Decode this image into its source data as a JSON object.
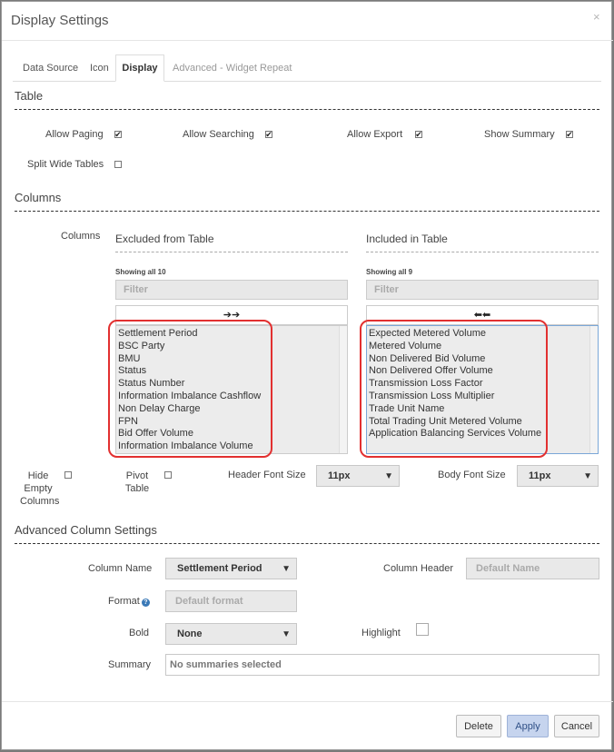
{
  "dialog": {
    "title": "Display Settings",
    "close_glyph": "×"
  },
  "tabs": [
    {
      "label": "Data Source"
    },
    {
      "label": "Icon"
    },
    {
      "label": "Display"
    },
    {
      "label": "Advanced - Widget Repeat"
    }
  ],
  "table_section": {
    "title": "Table",
    "allow_paging": {
      "label": "Allow Paging",
      "checked": true
    },
    "allow_searching": {
      "label": "Allow Searching",
      "checked": true
    },
    "allow_export": {
      "label": "Allow Export",
      "checked": true
    },
    "show_summary": {
      "label": "Show Summary",
      "checked": true
    },
    "split_wide_tables": {
      "label": "Split Wide Tables",
      "checked": false
    },
    "check_glyph": "✔"
  },
  "columns_section": {
    "title": "Columns",
    "label": "Columns",
    "excluded": {
      "title": "Excluded from Table",
      "count_text": "Showing all 10",
      "filter_placeholder": "Filter",
      "move_glyph": "➔➔",
      "items": [
        "Settlement Period",
        "BSC Party",
        "BMU",
        "Status",
        "Status Number",
        "Information Imbalance Cashflow",
        "Non Delay Charge",
        "FPN",
        "Bid Offer Volume",
        "Information Imbalance Volume"
      ]
    },
    "included": {
      "title": "Included in Table",
      "count_text": "Showing all 9",
      "filter_placeholder": "Filter",
      "move_glyph": "⬅⬅",
      "items": [
        "Expected Metered Volume",
        "Metered Volume",
        "Non Delivered Bid Volume",
        "Non Delivered Offer Volume",
        "Transmission Loss Factor",
        "Transmission Loss Multiplier",
        "Trade Unit Name",
        "Total Trading Unit Metered Volume",
        "Application Balancing Services Volume"
      ]
    },
    "hide_empty_columns": {
      "line1": "Hide",
      "line2": "Empty",
      "line3": "Columns",
      "checked": false
    },
    "pivot_table": {
      "line1": "Pivot",
      "line2": "Table",
      "checked": false
    },
    "header_font_size": {
      "label": "Header Font Size",
      "value": "11px"
    },
    "body_font_size": {
      "label": "Body Font Size",
      "value": "11px"
    },
    "dropdown_glyph": "▼"
  },
  "advanced_section": {
    "title": "Advanced Column Settings",
    "column_name": {
      "label": "Column Name",
      "value": "Settlement Period"
    },
    "column_header": {
      "label": "Column Header",
      "placeholder": "Default Name"
    },
    "format": {
      "label": "Format",
      "placeholder": "Default format",
      "help_glyph": "?"
    },
    "bold": {
      "label": "Bold",
      "value": "None"
    },
    "highlight": {
      "label": "Highlight",
      "checked": false
    },
    "summary": {
      "label": "Summary",
      "value": "No summaries selected"
    }
  },
  "footer": {
    "delete_label": "Delete",
    "apply_label": "Apply",
    "cancel_label": "Cancel"
  },
  "colors": {
    "annotation_red": "#e23030",
    "apply_button_bg": "#c6d4ee"
  }
}
